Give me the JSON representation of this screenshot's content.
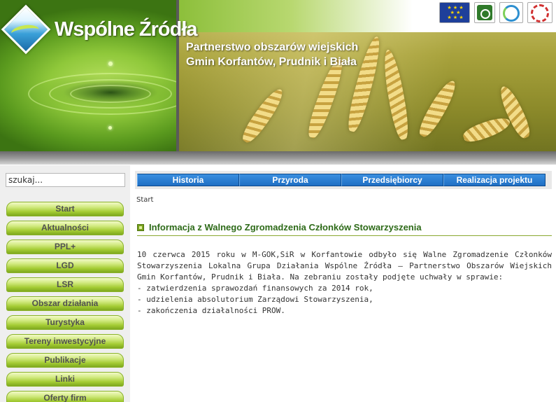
{
  "header": {
    "site_title": "Wspólne Źródła",
    "subtitle": "Partnerstwo obszarów wiejskich Gmin Korfantów, Prudnik i Biała",
    "partner_logos": [
      "eu-flag-icon",
      "leader-logo-icon",
      "blue-circle-logo-icon",
      "round-emblem-logo-icon"
    ]
  },
  "search": {
    "placeholder": "szukaj..."
  },
  "sidebar": {
    "items": [
      {
        "label": "Start"
      },
      {
        "label": "Aktualności"
      },
      {
        "label": "PPL+"
      },
      {
        "label": "LGD"
      },
      {
        "label": "LSR"
      },
      {
        "label": "Obszar działania"
      },
      {
        "label": "Turystyka"
      },
      {
        "label": "Tereny inwestycyjne"
      },
      {
        "label": "Publikacje"
      },
      {
        "label": "Linki"
      },
      {
        "label": "Oferty firm"
      }
    ]
  },
  "topnav": {
    "items": [
      {
        "label": "Historia"
      },
      {
        "label": "Przyroda"
      },
      {
        "label": "Przedsiębiorcy"
      },
      {
        "label": "Realizacja projektu"
      }
    ]
  },
  "breadcrumb": "Start",
  "article": {
    "heading": "Informacja z Walnego Zgromadzenia Członków Stowarzyszenia",
    "body": "10 czerwca 2015 roku w M-GOK,SiR w Korfantowie odbyło się Walne Zgromadzenie Członków Stowarzyszenia Lokalna Grupa Działania Wspólne Źródła – Partnerstwo Obszarów Wiejskich Gmin Korfantów, Prudnik i Biała. Na zebraniu zostały podjęte uchwały w sprawie:",
    "list": [
      "- zatwierdzenia sprawozdań finansowych za 2014 rok,",
      "- udzielenia absolutorium Zarządowi Stowarzyszenia,",
      "- zakończenia działalności PROW."
    ]
  },
  "colors": {
    "menu_green": "#a4cc34",
    "nav_blue": "#1f6fc4",
    "heading_green": "#2d6a18"
  }
}
